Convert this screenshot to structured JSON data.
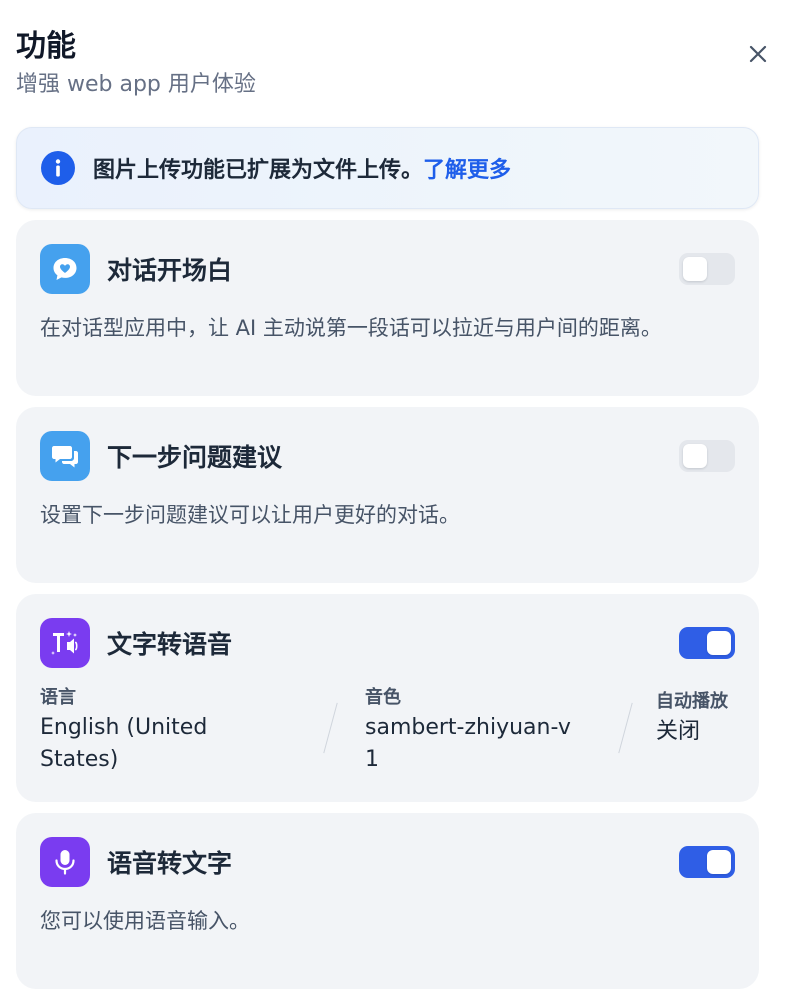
{
  "header": {
    "title": "功能",
    "subtitle": "增强 web app 用户体验"
  },
  "notice": {
    "text": "图片上传功能已扩展为文件上传。",
    "link": "了解更多",
    "icon": "info-icon",
    "accent": "#1e5eea"
  },
  "features": [
    {
      "title": "对话开场白",
      "description": "在对话型应用中，让 AI 主动说第一段话可以拉近与用户间的距离。",
      "enabled": false,
      "icon": "chat-bubble-heart-icon"
    },
    {
      "title": "下一步问题建议",
      "description": "设置下一步问题建议可以让用户更好的对话。",
      "enabled": false,
      "icon": "chat-suggestions-icon"
    },
    {
      "title": "文字转语音",
      "enabled": true,
      "icon": "text-to-speech-icon",
      "settings": {
        "language_label": "语言",
        "language_value": "English (United States)",
        "voice_label": "音色",
        "voice_value": "sambert-zhiyuan-v1",
        "autoplay_label": "自动播放",
        "autoplay_value": "关闭"
      }
    },
    {
      "title": "语音转文字",
      "description": "您可以使用语音输入。",
      "enabled": true,
      "icon": "microphone-icon"
    }
  ],
  "colors": {
    "toggle_on": "#2f5ee6",
    "toggle_off": "#e4e7ec",
    "blue_icon_bg": "#45a1ee",
    "purple_icon_bg": "#7a3cf0"
  }
}
